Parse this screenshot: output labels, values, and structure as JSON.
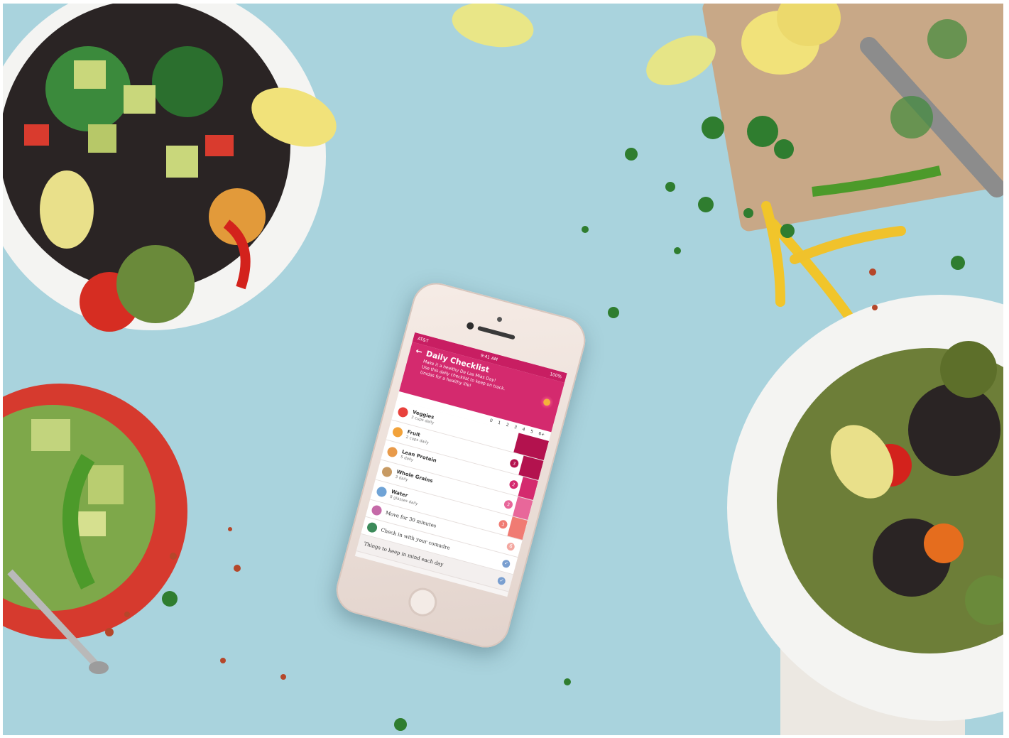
{
  "colors": {
    "table": "#a9d3dd",
    "accent": "#d42a6e",
    "accent_dark": "#c81e62",
    "bar_levels": [
      "#b3124e",
      "#d42a6e",
      "#e8679a",
      "#f07b73"
    ],
    "check": "#7a9fd0"
  },
  "phone": {
    "status": {
      "carrier": "AT&T",
      "time": "9:41 AM",
      "battery": "100%"
    },
    "header": {
      "back_icon": "arrow-left-icon",
      "title": "Daily Checklist",
      "subtitle_lines": [
        "Make it a healthy De Las Mias Day!",
        "Use this daily checklist to keep on track.",
        "Unidas for a healthy life!"
      ]
    },
    "scale_labels": [
      "0",
      "1",
      "2",
      "3",
      "4",
      "5",
      "6+"
    ],
    "items": [
      {
        "name": "Veggies",
        "goal": "3 cups daily",
        "icon": "tomato-icon",
        "icon_color": "#e8413c",
        "count": "",
        "badge_color": "",
        "level": 1.0
      },
      {
        "name": "Fruit",
        "goal": "2 cups daily",
        "icon": "orange-icon",
        "icon_color": "#f2a23a",
        "count": "3",
        "badge_color": "#b3124e",
        "level": 0.66
      },
      {
        "name": "Lean Protein",
        "goal": "5 daily",
        "icon": "chicken-icon",
        "icon_color": "#e89a4a",
        "count": "2",
        "badge_color": "#d42a6e",
        "level": 0.5
      },
      {
        "name": "Whole Grains",
        "goal": "3 daily",
        "icon": "bread-icon",
        "icon_color": "#c79a63",
        "count": "3",
        "badge_color": "#e8679a",
        "level": 0.5
      },
      {
        "name": "Water",
        "goal": "8 glasses daily",
        "icon": "glass-icon",
        "icon_color": "#6fa3d6",
        "count": "3",
        "badge_color": "#f07b73",
        "level": 0.5
      }
    ],
    "tasks": [
      {
        "label": "Move for 30 minutes",
        "icon": "running-icon",
        "icon_color": "#c56aa8",
        "state": "6",
        "checked": false
      },
      {
        "label": "Check in with your comadre",
        "icon": "heart-icon",
        "icon_color": "#3c8a5a",
        "state": "✓",
        "checked": true
      },
      {
        "label": "Things to keep in mind each day",
        "icon": "",
        "icon_color": "",
        "state": "✓",
        "checked": true
      }
    ]
  }
}
